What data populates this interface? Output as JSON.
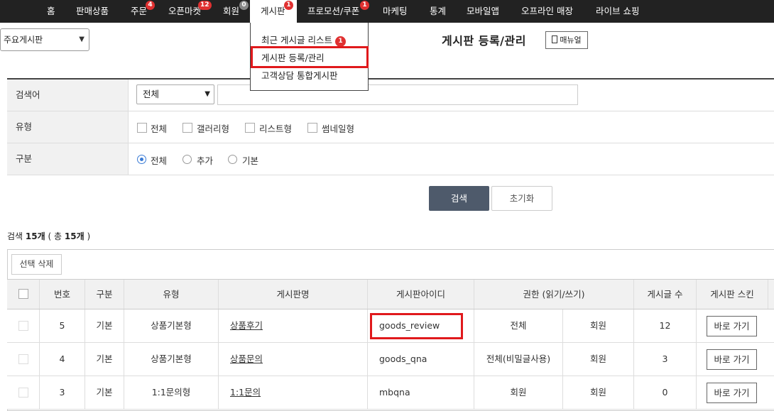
{
  "nav": {
    "items": [
      {
        "label": "홈",
        "badge": ""
      },
      {
        "label": "판매상품",
        "badge": ""
      },
      {
        "label": "주문",
        "badge": "4"
      },
      {
        "label": "오픈마켓",
        "badge": "12"
      },
      {
        "label": "회원",
        "badge": "0"
      },
      {
        "label": "게시판",
        "badge": "1"
      },
      {
        "label": "프로모션/쿠폰",
        "badge": "1"
      },
      {
        "label": "마케팅",
        "badge": ""
      },
      {
        "label": "통계",
        "badge": ""
      },
      {
        "label": "모바일앱",
        "badge": ""
      },
      {
        "label": "오프라인 매장",
        "badge": ""
      },
      {
        "label": "라이브 쇼핑",
        "badge": ""
      }
    ],
    "active": "게시판"
  },
  "board_select": {
    "value": "주요게시판"
  },
  "dropdown": {
    "items": [
      {
        "label": "최근 게시글 리스트",
        "badge": "1"
      },
      {
        "label": "게시판 등록/관리",
        "badge": ""
      },
      {
        "label": "고객상담 통합게시판",
        "badge": ""
      }
    ]
  },
  "header": {
    "title": "게시판 등록/관리",
    "manual_label": "매뉴얼"
  },
  "search": {
    "keyword_label": "검색어",
    "keyword_type": "전체",
    "keyword_value": "",
    "type_label": "유형",
    "type_options": [
      "전체",
      "갤러리형",
      "리스트형",
      "썸네일형"
    ],
    "category_label": "구분",
    "category_options": [
      "전체",
      "추가",
      "기본"
    ],
    "category_selected": "전체",
    "search_button": "검색",
    "reset_button": "초기화"
  },
  "result": {
    "prefix": "검색",
    "count": "15개",
    "mid": "( 총",
    "total": "15개",
    "suffix": ")"
  },
  "table": {
    "delete_button": "선택 삭제",
    "columns": [
      "번호",
      "구분",
      "유형",
      "게시판명",
      "게시판아이디",
      "권한 (읽기/쓰기)",
      "게시글 수",
      "게시판 스킨"
    ],
    "rows": [
      {
        "no": "5",
        "category": "기본",
        "type": "상품기본형",
        "name": "상품후기",
        "id": "goods_review",
        "read": "전체",
        "write": "회원",
        "posts": "12",
        "skin": "바로 가기"
      },
      {
        "no": "4",
        "category": "기본",
        "type": "상품기본형",
        "name": "상품문의",
        "id": "goods_qna",
        "read": "전체(비밀글사용)",
        "write": "회원",
        "posts": "3",
        "skin": "바로 가기"
      },
      {
        "no": "3",
        "category": "기본",
        "type": "1:1문의형",
        "name": "1:1문의",
        "id": "mbqna",
        "read": "회원",
        "write": "회원",
        "posts": "0",
        "skin": "바로 가기"
      }
    ]
  },
  "colors": {
    "nav_bg": "#222222",
    "badge": "#e03131",
    "highlight": "#e0191c",
    "search_btn": "#4e5a6b",
    "radio_on": "#3a7bd5"
  }
}
